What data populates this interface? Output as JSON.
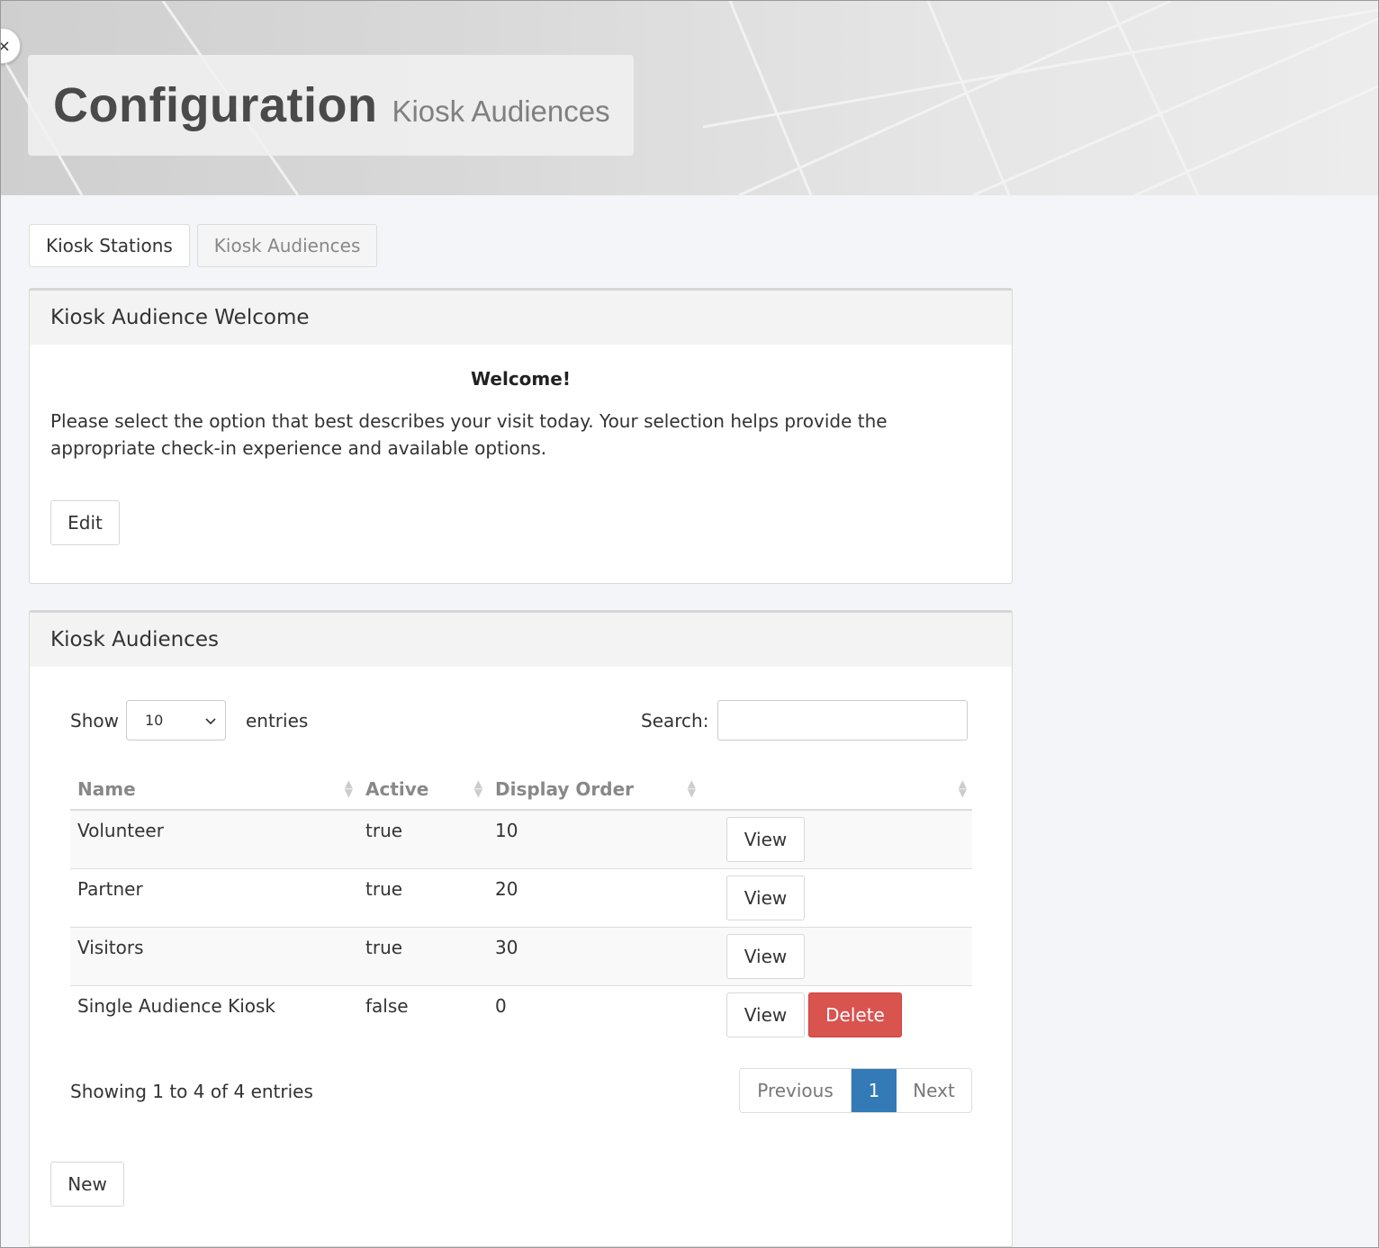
{
  "header": {
    "title": "Configuration",
    "subtitle": "Kiosk Audiences",
    "close_glyph": "×"
  },
  "tabs": [
    {
      "label": "Kiosk Stations",
      "active": false
    },
    {
      "label": "Kiosk Audiences",
      "active": true
    }
  ],
  "welcome_panel": {
    "heading": "Kiosk Audience Welcome",
    "title": "Welcome!",
    "text": "Please select the option that best describes your visit today. Your selection helps provide the appropriate check-in experience and available options.",
    "edit_label": "Edit"
  },
  "audiences_panel": {
    "heading": "Kiosk Audiences",
    "show_label": "Show",
    "entries_label": "entries",
    "page_size": "10",
    "search_label": "Search:",
    "search_value": "",
    "columns": [
      "Name",
      "Active",
      "Display Order",
      ""
    ],
    "rows": [
      {
        "name": "Volunteer",
        "active": "true",
        "order": "10",
        "view": "View"
      },
      {
        "name": "Partner",
        "active": "true",
        "order": "20",
        "view": "View"
      },
      {
        "name": "Visitors",
        "active": "true",
        "order": "30",
        "view": "View"
      },
      {
        "name": "Single Audience Kiosk",
        "active": "false",
        "order": "0",
        "view": "View",
        "delete": "Delete"
      }
    ],
    "info": "Showing 1 to 4 of 4 entries",
    "pager": {
      "previous": "Previous",
      "current": "1",
      "next": "Next"
    },
    "new_label": "New"
  },
  "colors": {
    "delete": "#d9534f",
    "page_active": "#337ab7"
  }
}
